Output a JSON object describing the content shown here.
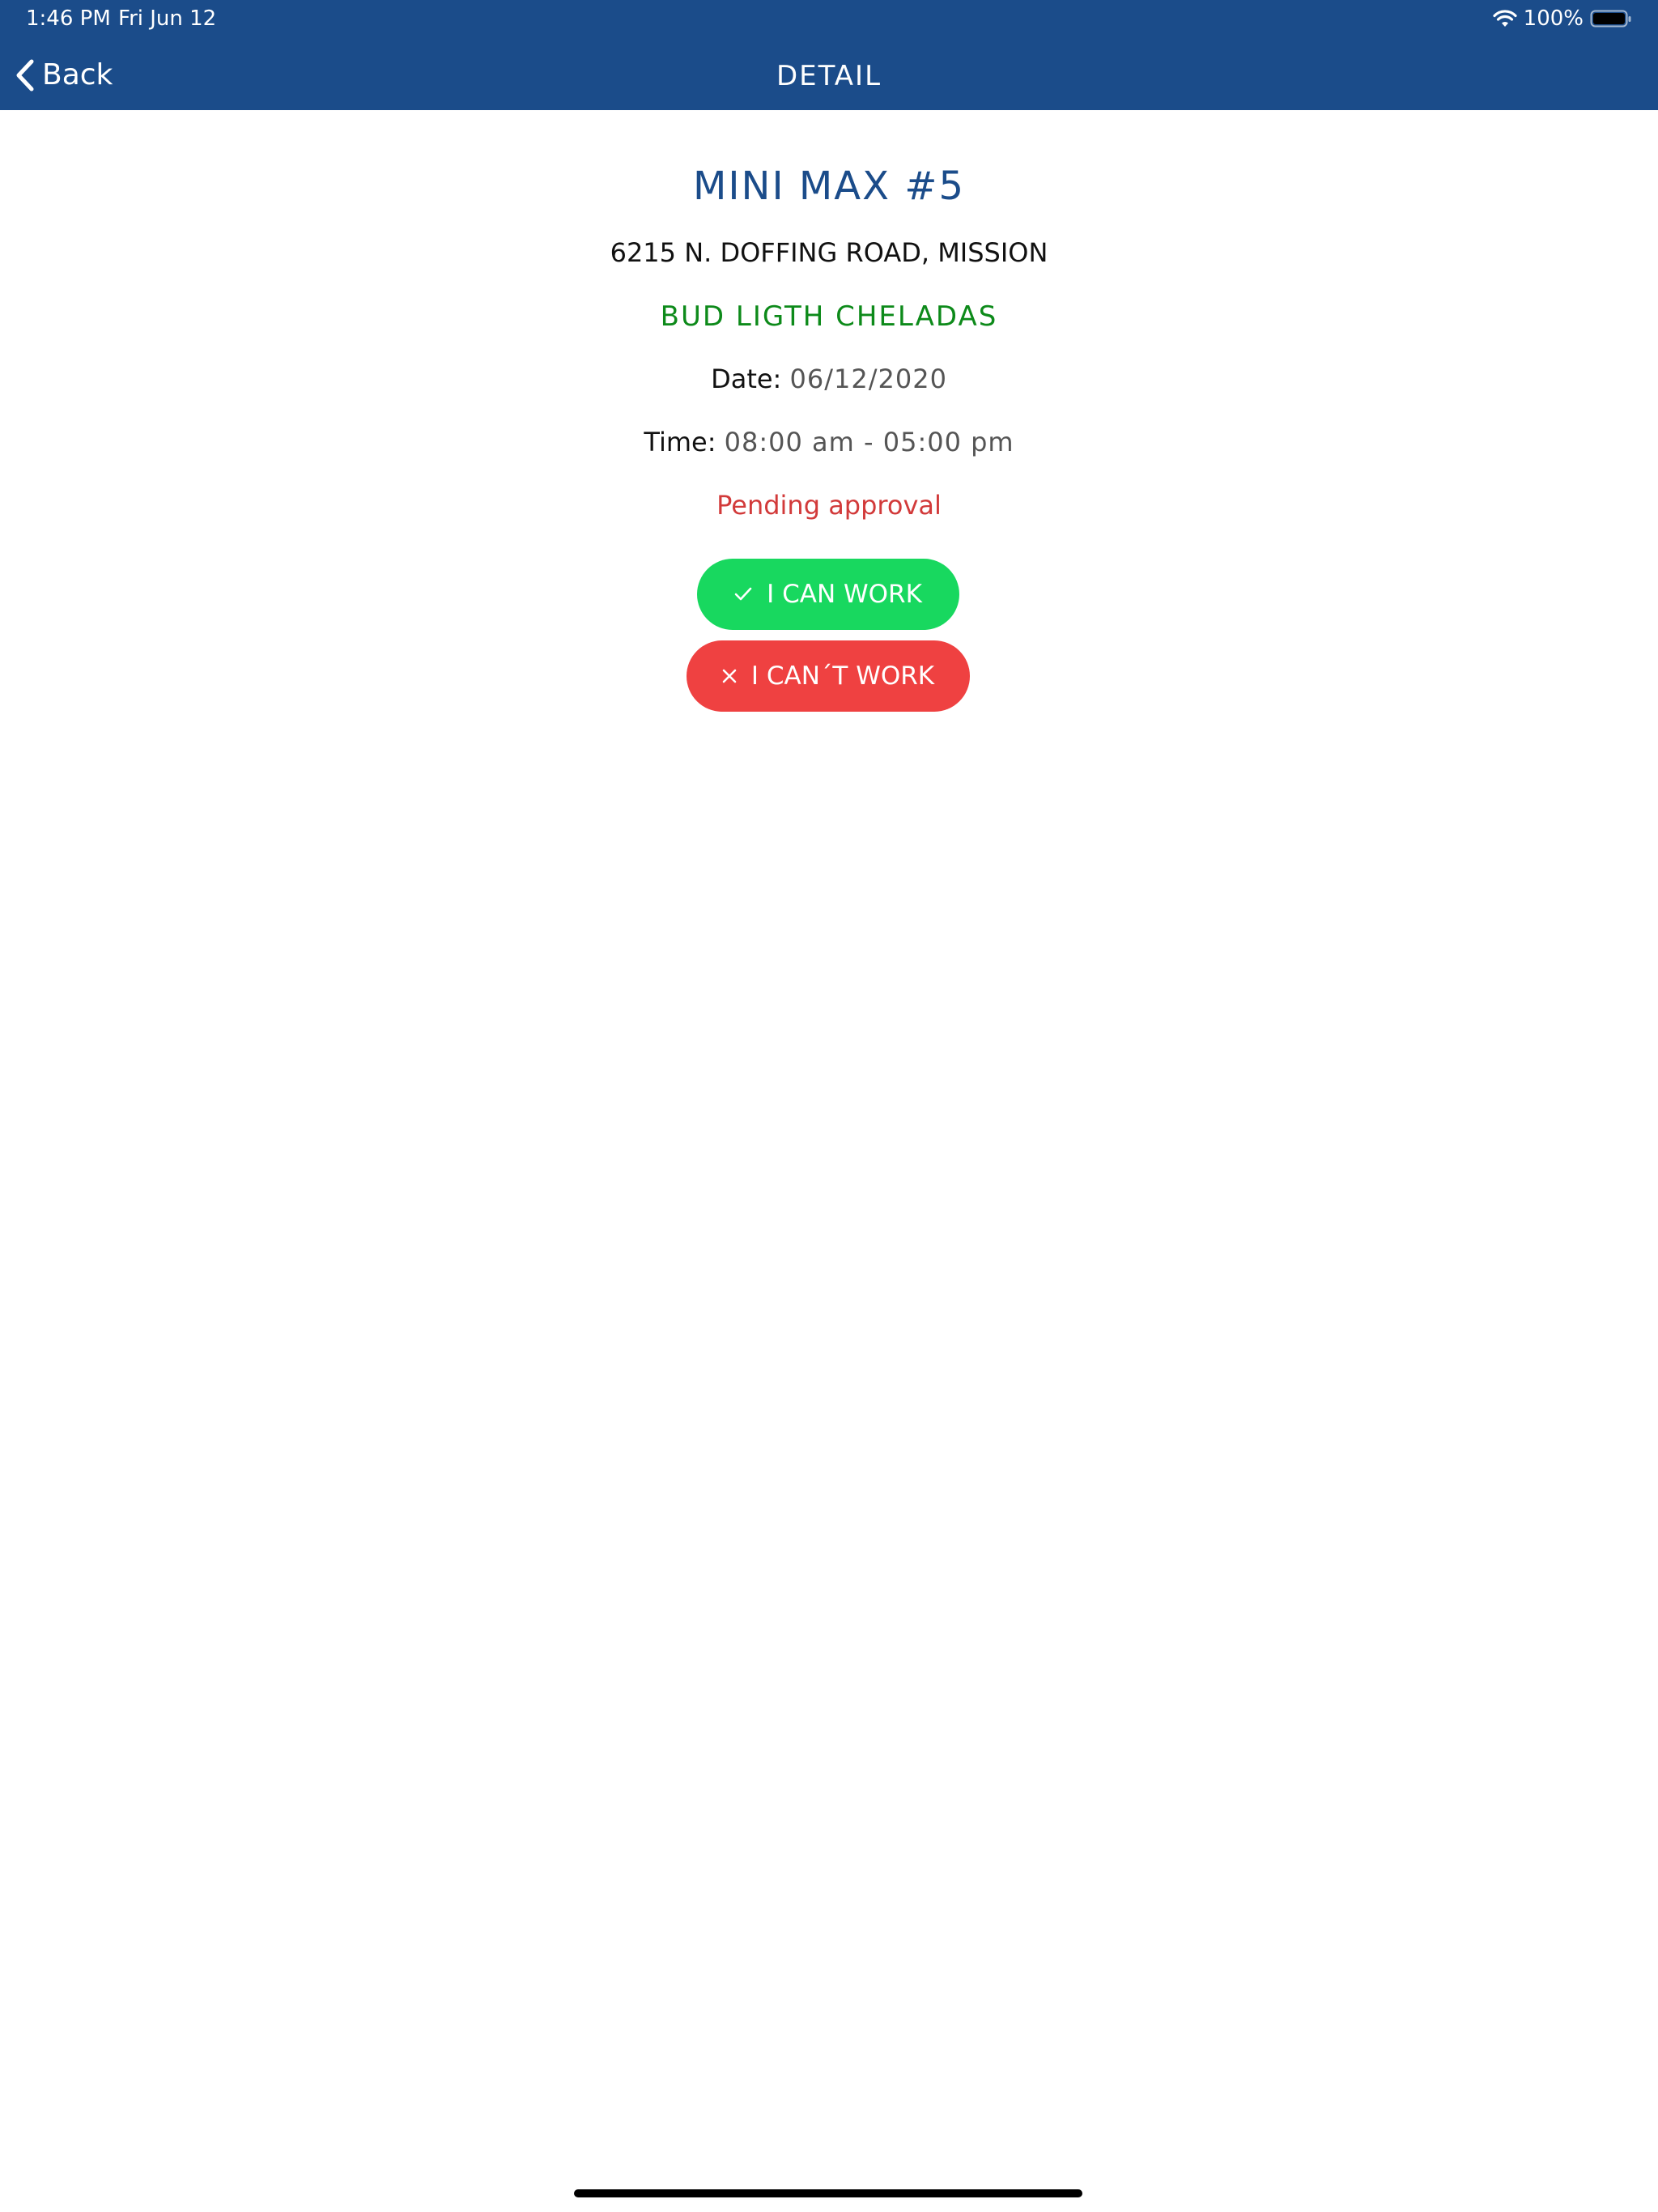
{
  "status_bar": {
    "time": "1:46 PM",
    "date": "Fri Jun 12",
    "battery": "100%",
    "wifi_icon": "wifi-icon",
    "battery_icon": "battery-icon"
  },
  "nav": {
    "back_label": "Back",
    "title": "DETAIL",
    "back_icon": "chevron-left-icon",
    "bar_color": "#1b4c8a"
  },
  "detail": {
    "store_name": "MINI MAX #5",
    "address": "6215 N. DOFFING ROAD, MISSION",
    "product": "BUD LIGTH CHELADAS",
    "date_label": "Date:",
    "date_value": "06/12/2020",
    "time_label": "Time:",
    "time_value": "08:00 am - 05:00 pm",
    "status": "Pending approval"
  },
  "actions": {
    "can_work_label": "I CAN WORK",
    "can_work_icon": "checkmark-icon",
    "can_work_color": "#18d85f",
    "cant_work_label": "I CAN´T WORK",
    "cant_work_icon": "close-icon",
    "cant_work_color": "#ef4141"
  },
  "colors": {
    "title": "#1b4c8a",
    "product": "#0d8a1a",
    "status": "#d23a3a"
  }
}
